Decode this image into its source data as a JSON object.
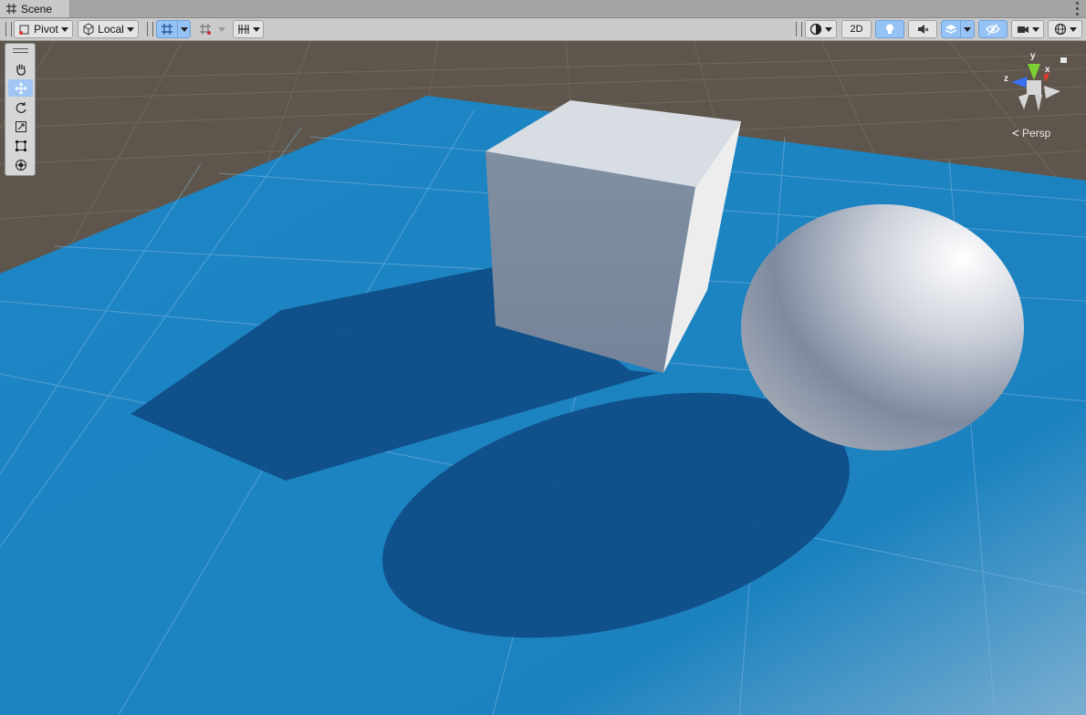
{
  "window": {
    "tab_label": "Scene",
    "tab_icon": "grid-hash-icon"
  },
  "toolbar": {
    "pivot_label": "Pivot",
    "local_label": "Local",
    "mode_2d_label": "2D",
    "grid_snap_active": true
  },
  "tools": [
    "hand-tool",
    "move-tool",
    "rotate-tool",
    "scale-tool",
    "rect-tool",
    "transform-tool"
  ],
  "active_tool": "move-tool",
  "gizmo": {
    "projection_label": "Persp",
    "axis_y_label": "y",
    "axis_z_label": "z",
    "axis_x_label": "x"
  },
  "scene_objects": [
    "plane",
    "cube",
    "sphere"
  ],
  "colors": {
    "plane_blue": "#1e87c5",
    "shadow_blue": "#0f4d87",
    "ground_brown": "#5f554b",
    "cube_face": "#7b8a9c",
    "cube_top": "#d8dde4",
    "active_button": "#96c3f5"
  }
}
